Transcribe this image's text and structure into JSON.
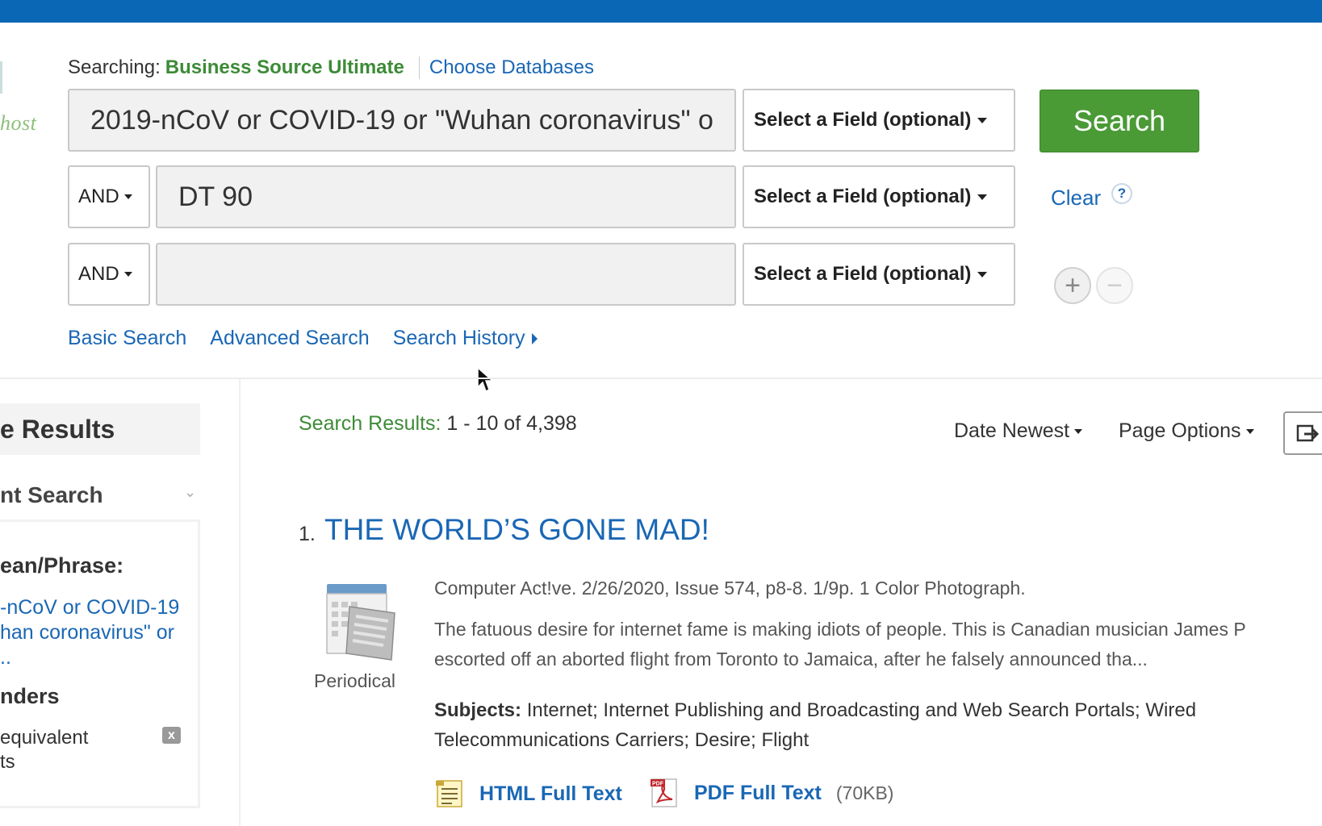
{
  "logo": {
    "text_fragment": "host"
  },
  "searching": {
    "label": "Searching:",
    "database": "Business Source Ultimate",
    "choose_databases": "Choose Databases"
  },
  "search_rows": [
    {
      "value": "2019-nCoV or COVID-19 or \"Wuhan coronavirus\" o",
      "field": "Select a Field (optional)"
    },
    {
      "bool": "AND",
      "value": "DT 90",
      "field": "Select a Field (optional)"
    },
    {
      "bool": "AND",
      "value": "",
      "field": "Select a Field (optional)"
    }
  ],
  "buttons": {
    "search": "Search",
    "clear": "Clear",
    "help": "?",
    "add_row": "+",
    "remove_row": "−"
  },
  "search_links": {
    "basic": "Basic Search",
    "advanced": "Advanced Search",
    "history": "Search History"
  },
  "sidebar": {
    "refine_title": "e Results",
    "current_search": "nt Search",
    "boolean_phrase_label": "ean/Phrase:",
    "boolean_phrase_value": "-nCoV or COVID-19\nhan coronavirus\" or\n..",
    "expanders_label": "nders",
    "expander_item": "equivalent\nts",
    "remove_icon": "x"
  },
  "results": {
    "label": "Search Results:",
    "range": "1 - 10 of 4,398",
    "sort": "Date Newest",
    "page_options": "Page Options"
  },
  "result_item": {
    "number": "1.",
    "title": "THE WORLD’S GONE MAD!",
    "type_label": "Periodical",
    "citation": "Computer Act!ve. 2/26/2020, Issue 574, p8-8. 1/9p. 1 Color Photograph.",
    "abstract": "The fatuous desire for internet fame is making idiots of people. This is Canadian musician James P\nescorted off an aborted flight from Toronto to Jamaica, after he falsely announced tha...",
    "subjects_label": "Subjects:",
    "subjects": "Internet; Internet Publishing and Broadcasting and Web Search Portals; Wired Telecommunications Carriers; Desire; Flight",
    "html_full_text": "HTML Full Text",
    "pdf_full_text": "PDF Full Text",
    "pdf_size": "(70KB)"
  },
  "icons": {
    "pdf_badge": "PDF"
  },
  "colors": {
    "topbar": "#0a67b5",
    "link": "#1a67b5",
    "database_green": "#3d8b37",
    "search_button": "#4a9a36"
  }
}
